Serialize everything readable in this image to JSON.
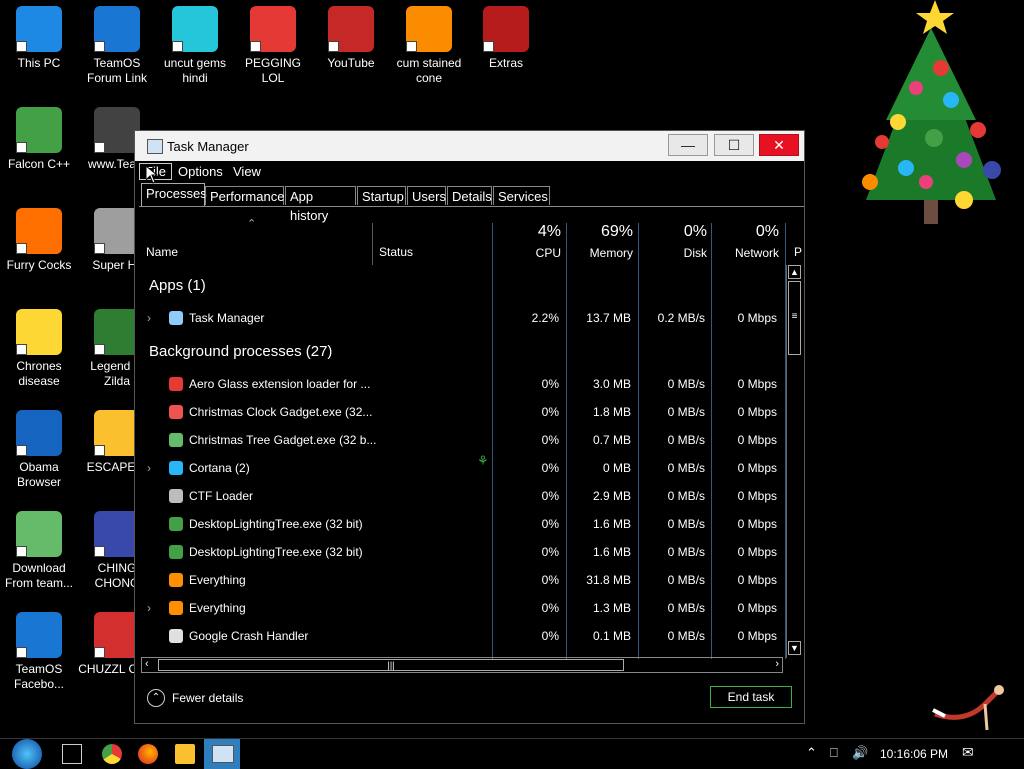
{
  "desktop": {
    "icons": [
      {
        "label": "This PC",
        "color": "#1e88e5"
      },
      {
        "label": "TeamOS Forum Link",
        "color": "#1976d2"
      },
      {
        "label": "uncut gems hindi",
        "color": "#26c6da"
      },
      {
        "label": "PEGGING LOL",
        "color": "#e53935"
      },
      {
        "label": "YouTube",
        "color": "#c62828"
      },
      {
        "label": "cum stained cone",
        "color": "#fb8c00"
      },
      {
        "label": "Extras",
        "color": "#b71c1c"
      },
      {
        "label": "Falcon C++",
        "color": "#43a047"
      },
      {
        "label": "www.Team",
        "color": "#424242"
      },
      {
        "label": "Furry Cocks",
        "color": "#ff6f00"
      },
      {
        "label": "Super Hil",
        "color": "#9e9e9e"
      },
      {
        "label": "Chrones disease",
        "color": "#fdd835"
      },
      {
        "label": "Legend of Zilda",
        "color": "#2e7d32"
      },
      {
        "label": "Obama Browser",
        "color": "#1565c0"
      },
      {
        "label": "ESCAPE C",
        "color": "#fbc02d"
      },
      {
        "label": "Download From team...",
        "color": "#66bb6a"
      },
      {
        "label": "CHING CHONG",
        "color": "#3949ab"
      },
      {
        "label": "TeamOS Facebo...",
        "color": "#1976d2"
      },
      {
        "label": "CHUZZL CUM",
        "color": "#d32f2f"
      }
    ]
  },
  "window": {
    "title": "Task Manager",
    "minimize": "—",
    "maximize": "☐",
    "close": "✕",
    "close_color": "#e81123"
  },
  "menu": [
    "File",
    "Options",
    "View"
  ],
  "tabs": [
    "Processes",
    "Performance",
    "App history",
    "Startup",
    "Users",
    "Details",
    "Services"
  ],
  "columns": {
    "name": "Name",
    "status": "Status",
    "cpu": {
      "pct": "4%",
      "label": "CPU"
    },
    "memory": {
      "pct": "69%",
      "label": "Memory"
    },
    "disk": {
      "pct": "0%",
      "label": "Disk"
    },
    "network": {
      "pct": "0%",
      "label": "Network"
    },
    "power": "P"
  },
  "groups": {
    "apps": "Apps (1)",
    "background": "Background processes (27)"
  },
  "apps": [
    {
      "name": "Task Manager",
      "cpu": "2.2%",
      "memory": "13.7 MB",
      "disk": "0.2 MB/s",
      "network": "0 Mbps",
      "icon_color": "#90caf9",
      "expand": true
    }
  ],
  "processes": [
    {
      "name": "Aero Glass extension loader for ...",
      "cpu": "0%",
      "memory": "3.0 MB",
      "disk": "0 MB/s",
      "network": "0 Mbps",
      "icon_color": "#e53935",
      "expand": false
    },
    {
      "name": "Christmas Clock Gadget.exe (32...",
      "cpu": "0%",
      "memory": "1.8 MB",
      "disk": "0 MB/s",
      "network": "0 Mbps",
      "icon_color": "#ef5350",
      "expand": false
    },
    {
      "name": "Christmas Tree Gadget.exe (32 b...",
      "cpu": "0%",
      "memory": "0.7 MB",
      "disk": "0 MB/s",
      "network": "0 Mbps",
      "icon_color": "#66bb6a",
      "expand": false
    },
    {
      "name": "Cortana (2)",
      "cpu": "0%",
      "memory": "0 MB",
      "disk": "0 MB/s",
      "network": "0 Mbps",
      "icon_color": "#29b6f6",
      "expand": true
    },
    {
      "name": "CTF Loader",
      "cpu": "0%",
      "memory": "2.9 MB",
      "disk": "0 MB/s",
      "network": "0 Mbps",
      "icon_color": "#bdbdbd",
      "expand": false
    },
    {
      "name": "DesktopLightingTree.exe (32 bit)",
      "cpu": "0%",
      "memory": "1.6 MB",
      "disk": "0 MB/s",
      "network": "0 Mbps",
      "icon_color": "#43a047",
      "expand": false
    },
    {
      "name": "DesktopLightingTree.exe (32 bit)",
      "cpu": "0%",
      "memory": "1.6 MB",
      "disk": "0 MB/s",
      "network": "0 Mbps",
      "icon_color": "#43a047",
      "expand": false
    },
    {
      "name": "Everything",
      "cpu": "0%",
      "memory": "31.8 MB",
      "disk": "0 MB/s",
      "network": "0 Mbps",
      "icon_color": "#ff8f00",
      "expand": false
    },
    {
      "name": "Everything",
      "cpu": "0%",
      "memory": "1.3 MB",
      "disk": "0 MB/s",
      "network": "0 Mbps",
      "icon_color": "#ff8f00",
      "expand": true
    },
    {
      "name": "Google Crash Handler",
      "cpu": "0%",
      "memory": "0.1 MB",
      "disk": "0 MB/s",
      "network": "0 Mbps",
      "icon_color": "#e0e0e0",
      "expand": false
    }
  ],
  "footer": {
    "fewer_details": "Fewer details",
    "end_task": "End task",
    "end_task_color": "#3cb043"
  },
  "taskbar": {
    "clock": "10:16:06 PM"
  },
  "accent": "#2d5a80"
}
